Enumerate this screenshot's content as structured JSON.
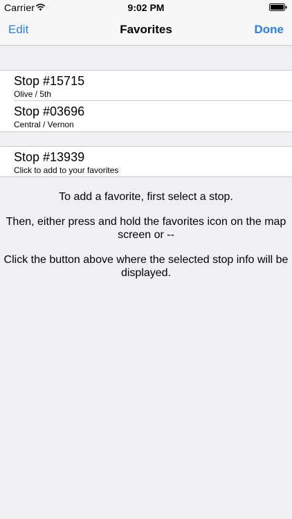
{
  "status_bar": {
    "carrier": "Carrier",
    "time": "9:02 PM",
    "icons": [
      "wifi-icon",
      "battery-icon"
    ]
  },
  "nav": {
    "left_button": "Edit",
    "title": "Favorites",
    "right_button": "Done",
    "accent_color": "#2a7ef5"
  },
  "favorites": [
    {
      "title": "Stop #15715",
      "subtitle": "Olive / 5th"
    },
    {
      "title": "Stop #03696",
      "subtitle": "Central / Vernon"
    }
  ],
  "selected_stop": {
    "title": "Stop #13939",
    "subtitle": "Click to add to your favorites"
  },
  "instructions": [
    "To add a favorite, first select a stop.",
    "Then, either press and hold the favorites icon on the map screen or --",
    "Click the button above where the selected stop info will be displayed."
  ]
}
